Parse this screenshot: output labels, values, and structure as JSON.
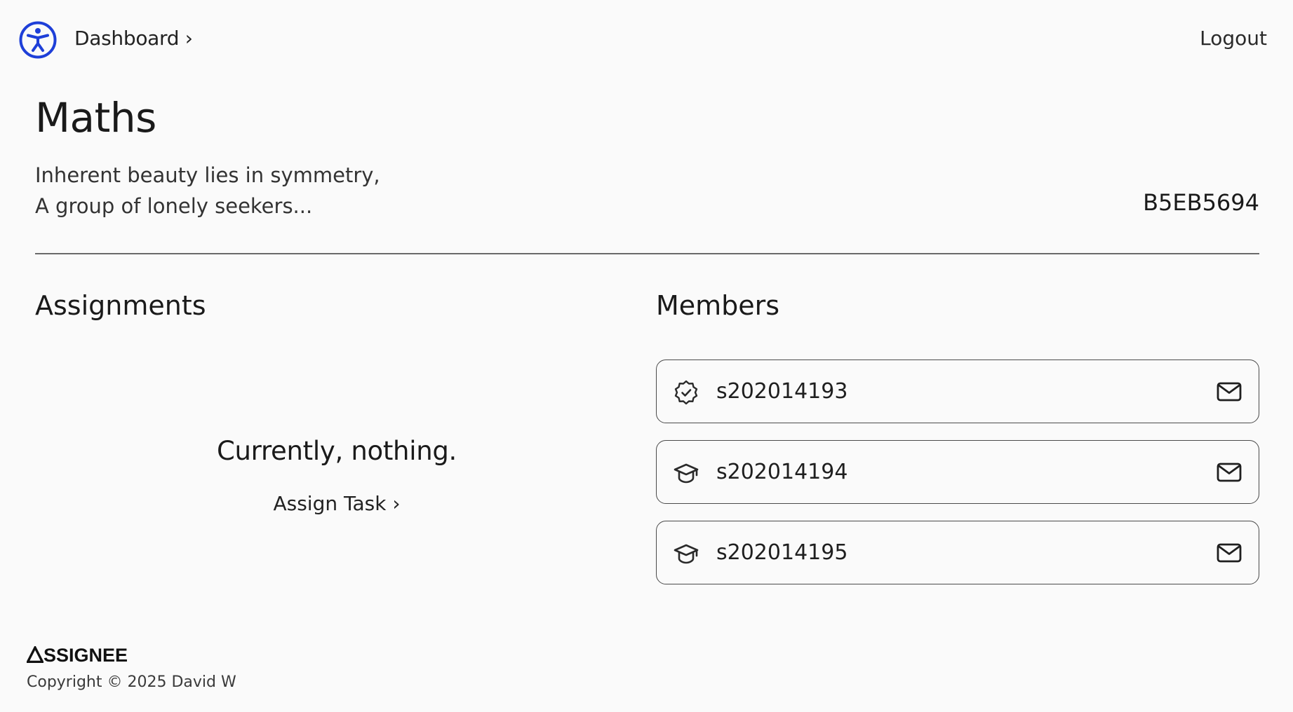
{
  "nav": {
    "brand_icon": "accessibility-icon",
    "breadcrumb": "Dashboard ›",
    "logout": "Logout",
    "accent_color": "#1e3fd8"
  },
  "course": {
    "title": "Maths",
    "description_line1": "Inherent beauty lies in symmetry,",
    "description_line2": "A group of lonely seekers...",
    "code": "B5EB5694"
  },
  "assignments": {
    "heading": "Assignments",
    "empty_text": "Currently, nothing.",
    "assign_task_label": "Assign Task ›"
  },
  "members": {
    "heading": "Members",
    "items": [
      {
        "id": "s202014193",
        "role_icon": "verified-badge-icon",
        "action_icon": "mail-icon"
      },
      {
        "id": "s202014194",
        "role_icon": "graduation-cap-icon",
        "action_icon": "mail-icon"
      },
      {
        "id": "s202014195",
        "role_icon": "graduation-cap-icon",
        "action_icon": "mail-icon"
      }
    ]
  },
  "footer": {
    "logo_text": "SSIGNEE",
    "copyright": "Copyright © 2025 David W"
  }
}
